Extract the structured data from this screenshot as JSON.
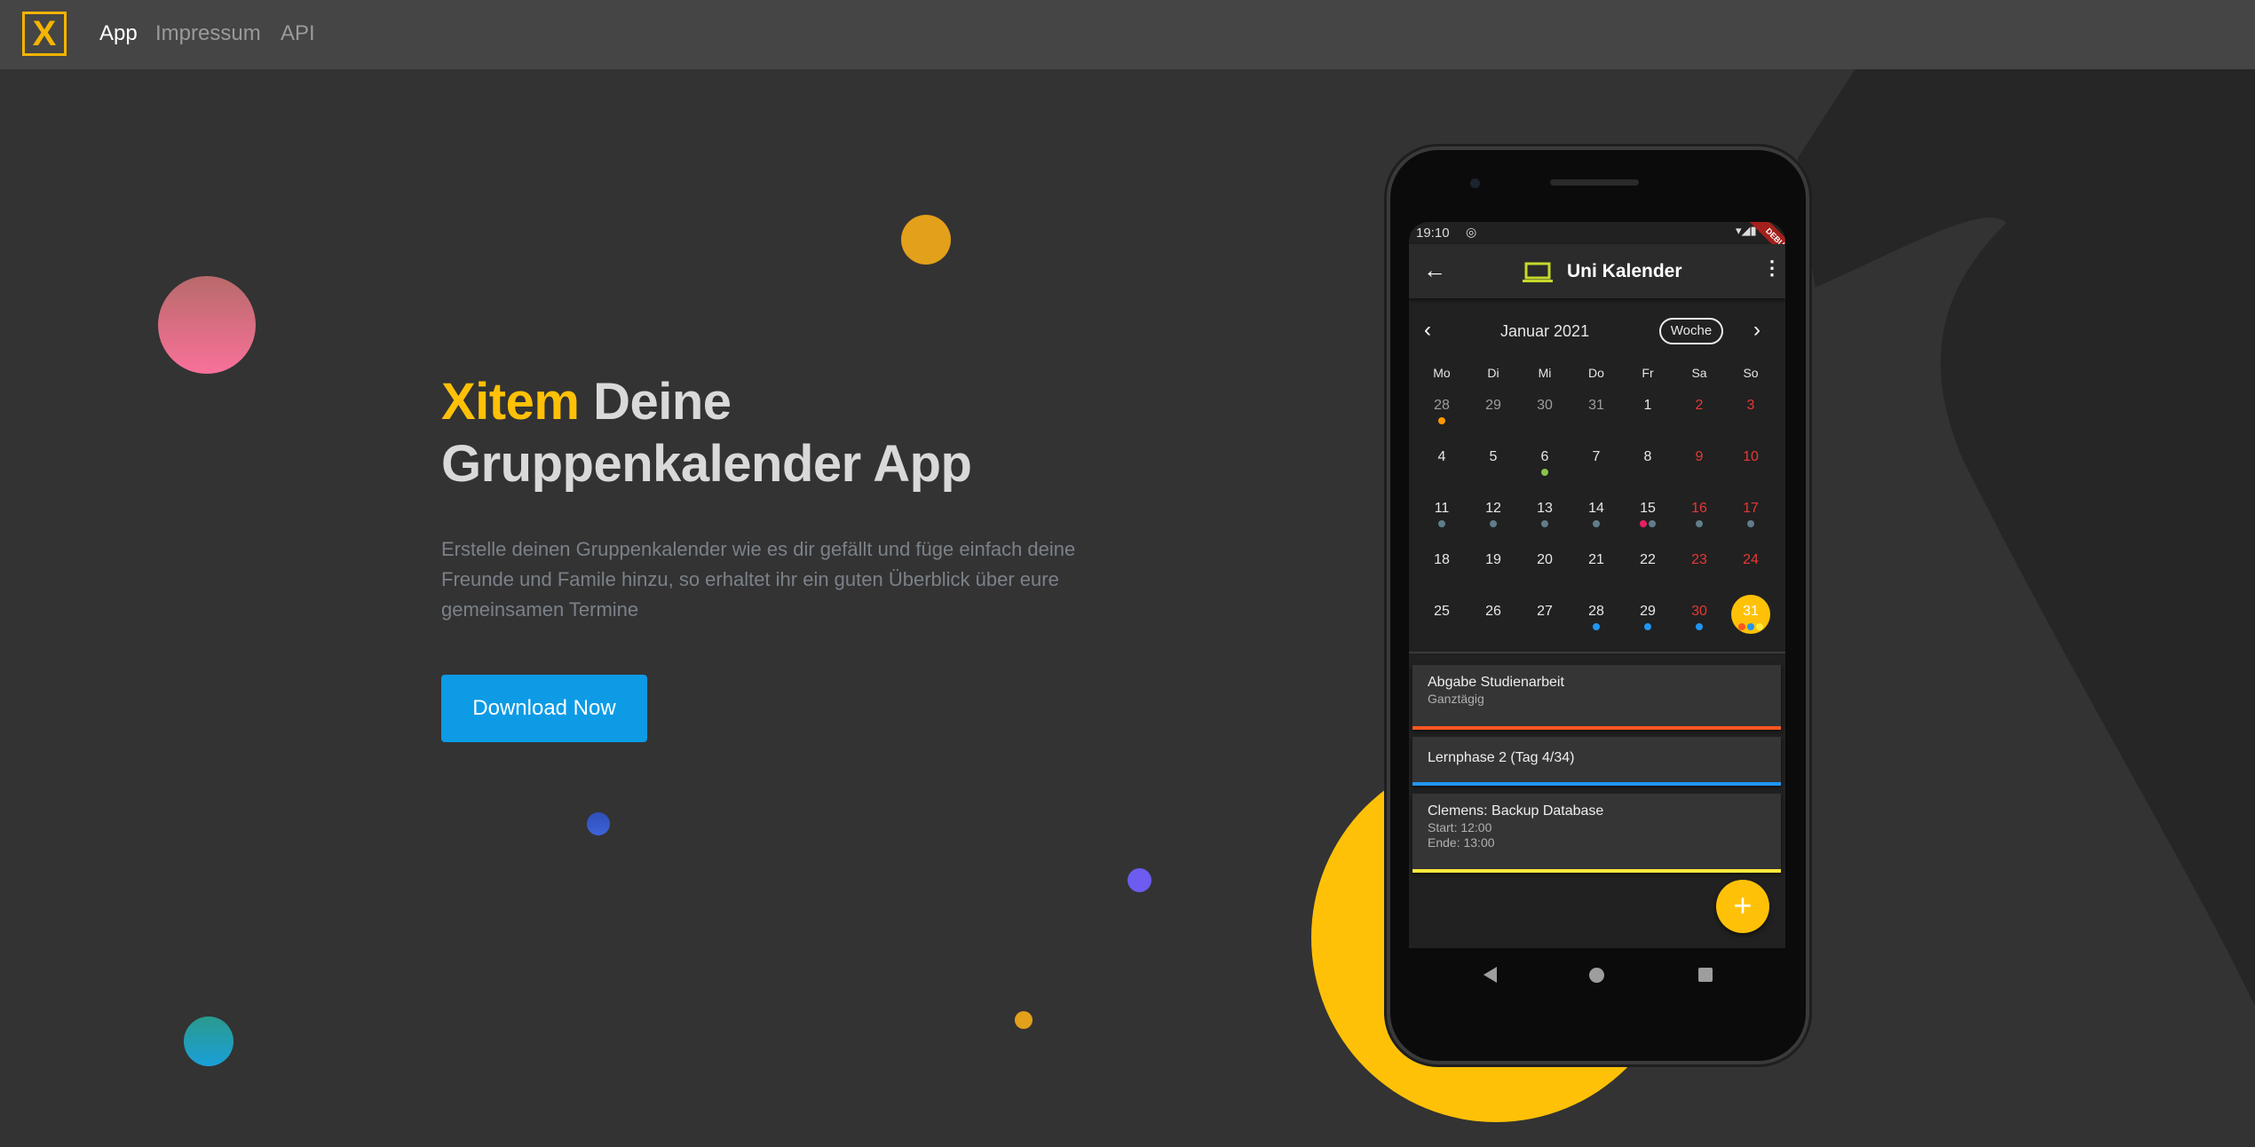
{
  "nav": {
    "logo": "X",
    "items": [
      {
        "label": "App",
        "active": true
      },
      {
        "label": "Impressum",
        "active": false
      },
      {
        "label": "API",
        "active": false
      }
    ]
  },
  "hero": {
    "brand": "Xitem",
    "title_rest": " Deine",
    "title_line2": "Gruppenkalender App",
    "description": "Erstelle deinen Gruppenkalender wie es dir gefällt und füge einfach deine Freunde und Famile hinzu, so erhaltet ihr ein guten Überblick über eure gemeinsamen Termine",
    "button": "Download Now"
  },
  "colors": {
    "accent": "#ffc107",
    "button": "#0d9be6",
    "bg": "#333333",
    "nav": "#454545"
  },
  "phone": {
    "status": {
      "time": "19:10",
      "debug": "DEBUG"
    },
    "appbar": {
      "title": "Uni Kalender",
      "icon": "laptop-icon"
    },
    "calendar": {
      "month": "Januar 2021",
      "view_button": "Woche",
      "weekdays": [
        "Mo",
        "Di",
        "Mi",
        "Do",
        "Fr",
        "Sa",
        "So"
      ],
      "weeks": [
        [
          {
            "d": "28",
            "m": 1,
            "dots": [
              "#ff9800"
            ]
          },
          {
            "d": "29",
            "m": 1
          },
          {
            "d": "30",
            "m": 1
          },
          {
            "d": "31",
            "m": 1
          },
          {
            "d": "1"
          },
          {
            "d": "2",
            "w": 1
          },
          {
            "d": "3",
            "w": 1
          }
        ],
        [
          {
            "d": "4"
          },
          {
            "d": "5"
          },
          {
            "d": "6",
            "dots": [
              "#8bc34a"
            ]
          },
          {
            "d": "7"
          },
          {
            "d": "8"
          },
          {
            "d": "9",
            "w": 1
          },
          {
            "d": "10",
            "w": 1
          }
        ],
        [
          {
            "d": "11",
            "dots": [
              "#607d8b"
            ]
          },
          {
            "d": "12",
            "dots": [
              "#607d8b"
            ]
          },
          {
            "d": "13",
            "dots": [
              "#607d8b"
            ]
          },
          {
            "d": "14",
            "dots": [
              "#607d8b"
            ]
          },
          {
            "d": "15",
            "dots": [
              "#e91e63",
              "#607d8b"
            ]
          },
          {
            "d": "16",
            "w": 1,
            "dots": [
              "#607d8b"
            ]
          },
          {
            "d": "17",
            "w": 1,
            "dots": [
              "#607d8b"
            ]
          }
        ],
        [
          {
            "d": "18"
          },
          {
            "d": "19"
          },
          {
            "d": "20"
          },
          {
            "d": "21"
          },
          {
            "d": "22"
          },
          {
            "d": "23",
            "w": 1
          },
          {
            "d": "24",
            "w": 1
          }
        ],
        [
          {
            "d": "25"
          },
          {
            "d": "26"
          },
          {
            "d": "27"
          },
          {
            "d": "28",
            "dots": [
              "#2196f3"
            ]
          },
          {
            "d": "29",
            "dots": [
              "#2196f3"
            ]
          },
          {
            "d": "30",
            "w": 1,
            "dots": [
              "#2196f3"
            ]
          },
          {
            "d": "31",
            "today": 1,
            "dots": [
              "#ff5722",
              "#2196f3",
              "#ffeb3b"
            ]
          }
        ]
      ]
    },
    "events": [
      {
        "title": "Abgabe Studienarbeit",
        "lines": [
          "Ganztägig"
        ],
        "color": "#ff5722"
      },
      {
        "title": "Lernphase 2 (Tag 4/34)",
        "lines": [],
        "color": "#2196f3"
      },
      {
        "title": "Clemens: Backup Database",
        "lines": [
          "Start: 12:00",
          "Ende: 13:00"
        ],
        "color": "#ffeb3b"
      }
    ],
    "fab": "+"
  }
}
